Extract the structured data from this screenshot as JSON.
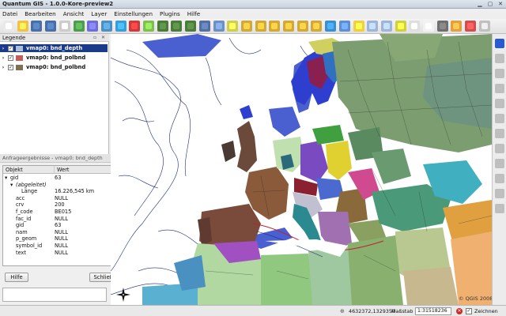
{
  "window": {
    "title": "Quantum GIS - 1.0.0-Kore-preview2"
  },
  "menu": [
    "Datei",
    "Bearbeiten",
    "Ansicht",
    "Layer",
    "Einstellungen",
    "Plugins",
    "Hilfe"
  ],
  "toolbar": {
    "icons": [
      "new-project-icon",
      "open-project-icon",
      "save-project-icon",
      "save-as-icon",
      "print-icon",
      "add-vector-layer-icon",
      "add-raster-layer-icon",
      "add-postgis-icon",
      "add-wms-icon",
      "remove-layer-icon",
      "new-vector-icon",
      "capture-point-icon",
      "capture-line-icon",
      "capture-polygon-icon",
      "eye-icon",
      "link-icon",
      "pan-icon",
      "zoom-in-icon",
      "zoom-out-icon",
      "zoom-full-icon",
      "zoom-selection-icon",
      "zoom-layer-icon",
      "zoom-last-icon",
      "refresh-icon",
      "identify-icon",
      "select-icon",
      "measure-line-icon",
      "measure-area-icon",
      "map-tips-icon",
      "bookmark-icon",
      "table-icon",
      "grass-icon",
      "plugin-icon",
      "overview-icon",
      "close-icon"
    ],
    "colors": [
      "#e9e9e9",
      "#f0c24a",
      "#4a6fa5",
      "#4a6fa5",
      "#cccccc",
      "#4f9c4f",
      "#6f6fcf",
      "#4f8fbf",
      "#3c9cd6",
      "#cc3b3b",
      "#7fbf4f",
      "#4c7a3c",
      "#4c7a3c",
      "#4c7a3c",
      "#556f9f",
      "#6f8fbf",
      "#cfcf4f",
      "#cfaa3a",
      "#cfaa3a",
      "#cfaa3a",
      "#cfaa3a",
      "#cfaa3a",
      "#cfaa3a",
      "#3c8fcf",
      "#5f8fcf",
      "#f0d040",
      "#9fb5d8",
      "#9fb5d8",
      "#d0d040",
      "#dfdfdf",
      "#f2f2f2",
      "#6f6f6f",
      "#e0a040",
      "#cf4f4f",
      "#c0c0c0"
    ]
  },
  "legend": {
    "title": "Legende",
    "layers": [
      {
        "name": "vmap0: bnd_depth",
        "selected": true,
        "symbol": "#aec0d8"
      },
      {
        "name": "vmap0: bnd_polbnd",
        "selected": false,
        "symbol": "#c45c5c"
      },
      {
        "name": "vmap0: bnd_polbnd",
        "selected": false,
        "symbol": "#7e6f55"
      }
    ]
  },
  "results": {
    "title": "Anfrageergebnisse - vmap0: bnd_depth",
    "columns": [
      "Objekt",
      "Wert"
    ],
    "rows": [
      {
        "indent": 0,
        "exp": "▾",
        "key": "gid",
        "value": "63"
      },
      {
        "indent": 1,
        "exp": "▾",
        "key": "(abgeleitet)",
        "value": ""
      },
      {
        "indent": 2,
        "exp": "",
        "key": "Länge",
        "value": "16.226,545 km"
      },
      {
        "indent": 1,
        "exp": "",
        "key": "acc",
        "value": "NULL"
      },
      {
        "indent": 1,
        "exp": "",
        "key": "crv",
        "value": "200"
      },
      {
        "indent": 1,
        "exp": "",
        "key": "f_code",
        "value": "BE015"
      },
      {
        "indent": 1,
        "exp": "",
        "key": "fac_id",
        "value": "NULL"
      },
      {
        "indent": 1,
        "exp": "",
        "key": "gid",
        "value": "63"
      },
      {
        "indent": 1,
        "exp": "",
        "key": "nam",
        "value": "NULL"
      },
      {
        "indent": 1,
        "exp": "",
        "key": "p_geom",
        "value": "NULL"
      },
      {
        "indent": 1,
        "exp": "",
        "key": "symbol_id",
        "value": "NULL"
      },
      {
        "indent": 1,
        "exp": "",
        "key": "text",
        "value": "NULL"
      }
    ],
    "help_button": "Hilfe",
    "close_button": "Schließen"
  },
  "map": {
    "watermark": "© QGIS 2008",
    "background": "#ffffff",
    "sea_blue": "#4a5fd0"
  },
  "status": {
    "coordinates": "4632372,1329350",
    "scale_label": "Maßstab",
    "scale_value": "1:31518236",
    "render_label": "Zeichnen"
  }
}
